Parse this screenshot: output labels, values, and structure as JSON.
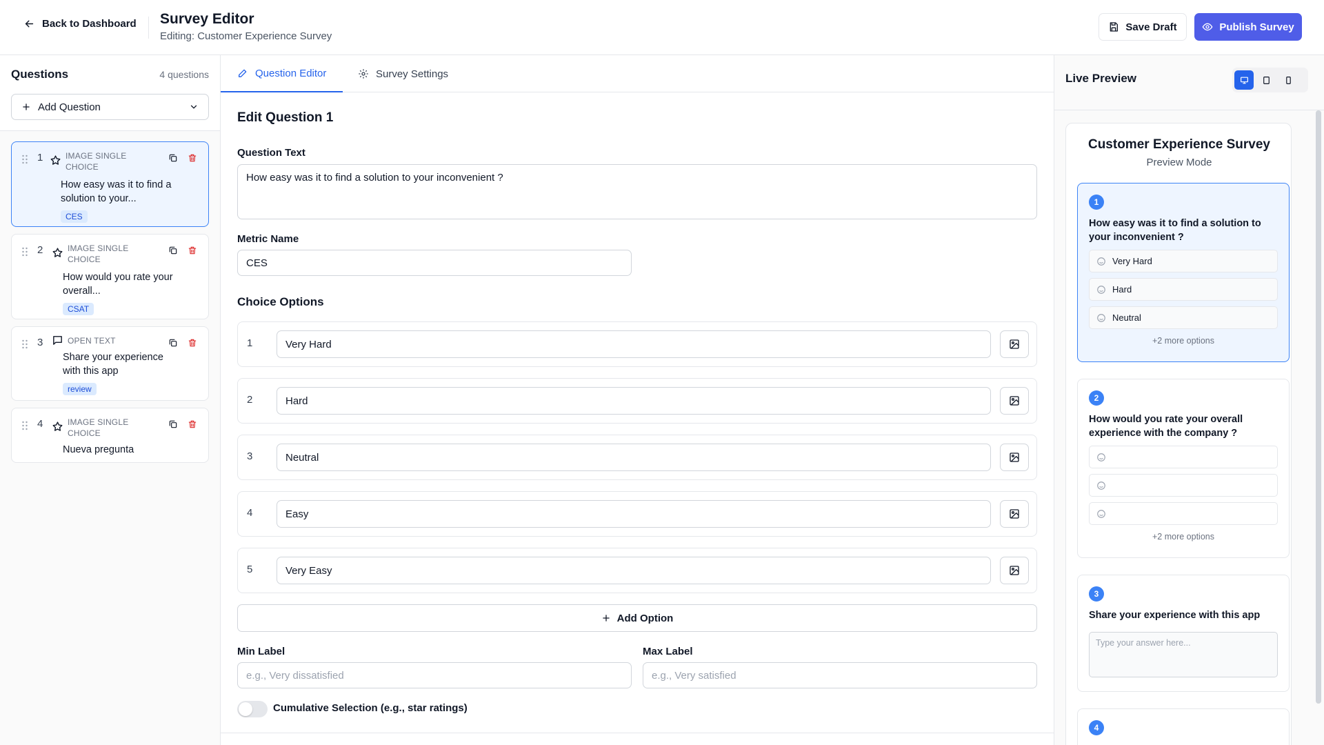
{
  "header": {
    "back_label": "Back to Dashboard",
    "title": "Survey Editor",
    "subtitle": "Editing: Customer Experience Survey",
    "save_draft_label": "Save Draft",
    "publish_label": "Publish Survey",
    "publish_color": "#4f5de8"
  },
  "questions_panel": {
    "title": "Questions",
    "count": "4 questions",
    "add_label": "Add Question",
    "items": [
      {
        "num": "1",
        "type": "IMAGE SINGLE CHOICE",
        "text": "How easy was it to find a solution to your...",
        "tag": "CES",
        "icon": "star-icon",
        "active": true
      },
      {
        "num": "2",
        "type": "IMAGE SINGLE CHOICE",
        "text": "How would you rate your overall...",
        "tag": "CSAT",
        "icon": "star-icon",
        "active": false
      },
      {
        "num": "3",
        "type": "OPEN TEXT",
        "text": "Share your experience with this app",
        "tag": "review",
        "icon": "message-icon",
        "active": false
      },
      {
        "num": "4",
        "type": "IMAGE SINGLE CHOICE",
        "text": "Nueva pregunta",
        "tag": "",
        "icon": "star-icon",
        "active": false
      }
    ]
  },
  "editor": {
    "tabs": [
      {
        "label": "Question Editor",
        "icon": "pencil-icon",
        "active": true
      },
      {
        "label": "Survey Settings",
        "icon": "gear-icon",
        "active": false
      }
    ],
    "edit_title": "Edit Question 1",
    "question_text_label": "Question Text",
    "question_text_value": "How easy was it to find a solution to your inconvenient ?",
    "metric_name_label": "Metric Name",
    "metric_name_value": "CES",
    "choice_options_title": "Choice Options",
    "choices": [
      {
        "num": "1",
        "value": "Very Hard"
      },
      {
        "num": "2",
        "value": "Hard"
      },
      {
        "num": "3",
        "value": "Neutral"
      },
      {
        "num": "4",
        "value": "Easy"
      },
      {
        "num": "5",
        "value": "Very Easy"
      }
    ],
    "add_option_label": "Add Option",
    "min_label": "Min Label",
    "min_placeholder": "e.g., Very dissatisfied",
    "max_label": "Max Label",
    "max_placeholder": "e.g., Very satisfied",
    "cumulative_label": "Cumulative Selection (e.g., star ratings)",
    "cumulative_on": false
  },
  "preview": {
    "title": "Live Preview",
    "devices": [
      {
        "name": "desktop-icon",
        "active": true
      },
      {
        "name": "tablet-icon",
        "active": false
      },
      {
        "name": "mobile-icon",
        "active": false
      }
    ],
    "survey_title": "Customer Experience Survey",
    "mode": "Preview Mode",
    "questions": [
      {
        "num": "1",
        "text": "How easy was it to find a solution to your inconvenient ?",
        "options": [
          "Very Hard",
          "Hard",
          "Neutral"
        ],
        "more": "+2 more options",
        "active": true
      },
      {
        "num": "2",
        "text": "How would you rate your overall experience with the company ?",
        "options": [
          "",
          "",
          ""
        ],
        "more": "+2 more options",
        "active": false
      },
      {
        "num": "3",
        "text": "Share your experience with this app",
        "placeholder": "Type your answer here...",
        "active": false
      },
      {
        "num": "4",
        "text": "",
        "active": false
      }
    ]
  }
}
